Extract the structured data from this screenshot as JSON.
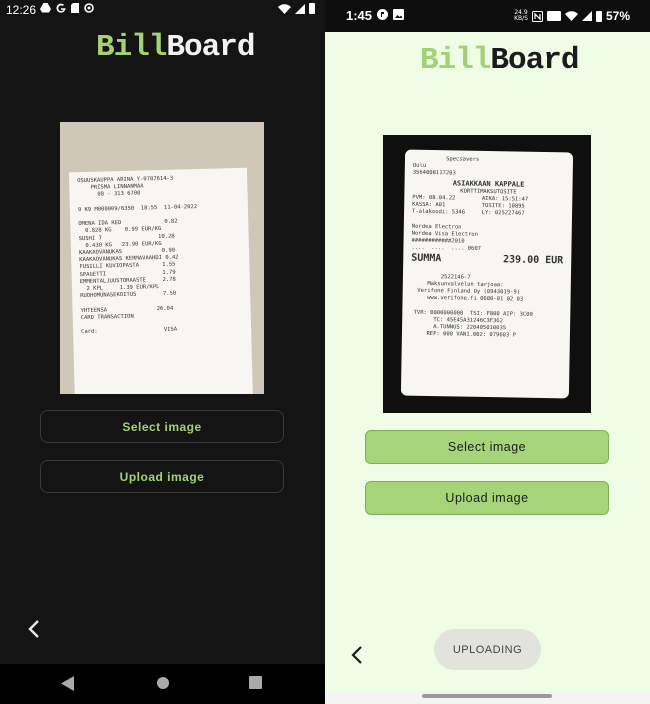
{
  "left": {
    "status_time": "12:26",
    "logo_a": "Bill",
    "logo_b": "Board",
    "select_label": "Select image",
    "upload_label": "Upload image",
    "receipt_lines": [
      "OSUUSKAUPPA ARINA Y-0787614-3",
      "    PRISMA LINNANMAA",
      "      08 - 313 6700",
      "",
      "9 K9 M000009/6350  18:55  11-04-2022",
      "",
      "OMENA IDA RED             0.82",
      "  0.828 KG    0.99 EUR/KG",
      "SUSHI 7                 10.28",
      "  0.430 KG   23.90 EUR/KG",
      "KAAKAOVANUKAS            0.90",
      "KAAKAOVANUKAS KERMAVAAHDI 0.42",
      "FUSILLI KUVIOPASTA       1.55",
      "SPAGETTI                 1.79",
      "EMMENTALJUUSTORAASTE     2.78",
      "  2 KPL     1.39 EUR/KPL",
      "RUOHOMUNASEKOITUS        7.50",
      "",
      "YHTEENSA               26.04",
      "CARD TRANSACTION",
      "",
      "Card:                    VISA"
    ]
  },
  "right": {
    "status_time": "1:45",
    "net_speed": "24.9",
    "net_unit": "KB/S",
    "battery_pct": "57%",
    "logo_a": "Bill",
    "logo_b": "Board",
    "select_label": "Select image",
    "upload_label": "Upload image",
    "uploading_label": "UPLOADING",
    "receipt_lines_top": [
      "          Specsavers",
      "Oulu",
      "3564008117203"
    ],
    "receipt_heading": "ASIAKKAAN KAPPALE",
    "receipt_subheading": "KORTTIMAKSUTOSITE",
    "receipt_lines_mid": [
      "PVM: 08.04.22        AIKA: 15:51:47",
      "KASSA: A01           TOSITE: 10895",
      "T-alakoodi: 5346     LY: 025227467",
      "",
      "Nordea Electron",
      "Nordea Visa Electron",
      "############2010",
      "....  ....  .... 0607"
    ],
    "receipt_sum_label": "SUMMA",
    "receipt_sum_value": "239.00 EUR",
    "receipt_lines_bottom": [
      "",
      "         2522146-7",
      "     Maksunvalvelun tarjoaa:",
      "  Verifone Finland Oy (0943019-9)",
      "     www.verifone.fi 0600-01 02 03",
      "",
      " TVR: 0000000000  TSI: F800 AIP: 3C00",
      "       TC: 45E45A31246C3F362",
      "       A.TUNNUS: 220405010035",
      "     REF: 000 VAN1.002: 079603 P"
    ]
  }
}
